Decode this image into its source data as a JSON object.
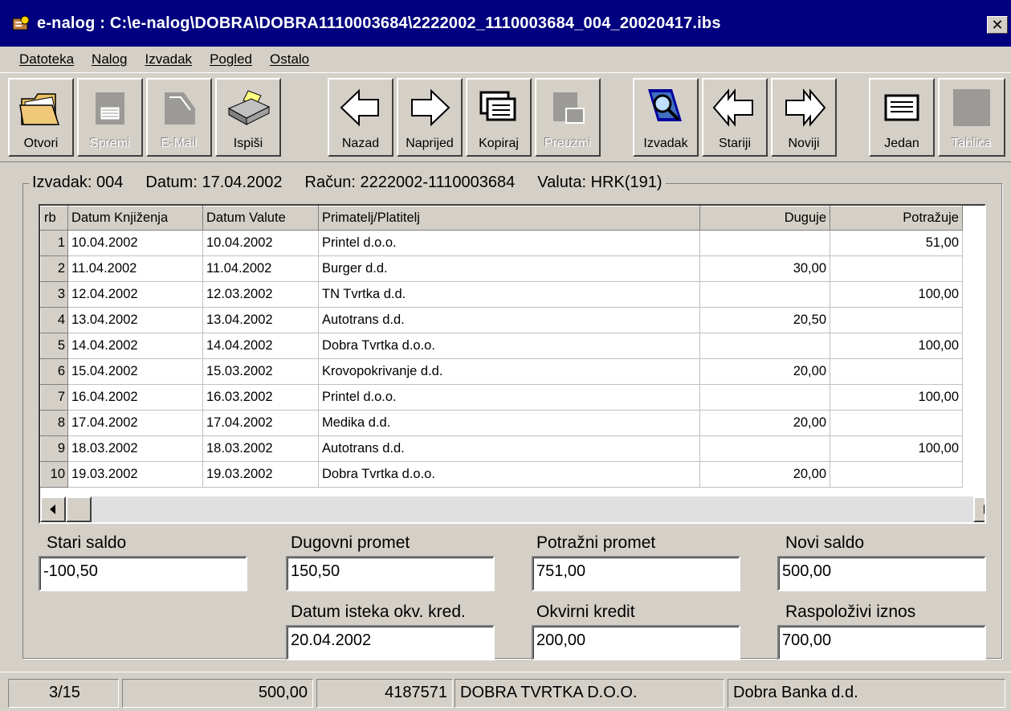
{
  "window": {
    "title": "e-nalog : C:\\e-nalog\\DOBRA\\DOBRA1110003684\\2222002_1110003684_004_20020417.ibs",
    "close_label": "✕"
  },
  "menu": {
    "items": [
      "Datoteka",
      "Nalog",
      "Izvadak",
      "Pogled",
      "Ostalo"
    ]
  },
  "toolbar": {
    "buttons": [
      {
        "label": "Otvori",
        "icon": "folder-icon",
        "enabled": true
      },
      {
        "label": "Spremi",
        "icon": "save-icon",
        "enabled": false
      },
      {
        "label": "E-Mail",
        "icon": "mail-icon",
        "enabled": false
      },
      {
        "label": "Ispiši",
        "icon": "printer-icon",
        "enabled": true
      },
      {
        "label": "Nazad",
        "icon": "arrow-left-icon",
        "enabled": true
      },
      {
        "label": "Naprijed",
        "icon": "arrow-right-icon",
        "enabled": true
      },
      {
        "label": "Kopiraj",
        "icon": "copy-icon",
        "enabled": true
      },
      {
        "label": "Preuzmi",
        "icon": "download-icon",
        "enabled": false
      },
      {
        "label": "Izvadak",
        "icon": "statement-search-icon",
        "enabled": true
      },
      {
        "label": "Stariji",
        "icon": "double-arrow-left-icon",
        "enabled": true
      },
      {
        "label": "Noviji",
        "icon": "double-arrow-right-icon",
        "enabled": true
      },
      {
        "label": "Jedan",
        "icon": "single-record-icon",
        "enabled": true
      },
      {
        "label": "Tablica",
        "icon": "table-icon",
        "enabled": false
      }
    ]
  },
  "statement": {
    "izvadak": "Izvadak: 004",
    "datum": "Datum: 17.04.2002",
    "racun": "Račun: 2222002-1110003684",
    "valuta": "Valuta: HRK(191)"
  },
  "grid": {
    "columns": {
      "rb": "rb",
      "datum_knjizenja": "Datum Knjiženja",
      "datum_valute": "Datum Valute",
      "primatelj": "Primatelj/Platitelj",
      "duguje": "Duguje",
      "potrazuje": "Potražuje"
    },
    "rows": [
      {
        "rb": "1",
        "dk": "10.04.2002",
        "dv": "10.04.2002",
        "name": "Printel d.o.o.",
        "duguje": "",
        "potrazuje": "51,00"
      },
      {
        "rb": "2",
        "dk": "11.04.2002",
        "dv": "11.04.2002",
        "name": "Burger d.d.",
        "duguje": "30,00",
        "potrazuje": ""
      },
      {
        "rb": "3",
        "dk": "12.04.2002",
        "dv": "12.03.2002",
        "name": "TN Tvrtka d.d.",
        "duguje": "",
        "potrazuje": "100,00"
      },
      {
        "rb": "4",
        "dk": "13.04.2002",
        "dv": "13.04.2002",
        "name": "Autotrans d.d.",
        "duguje": "20,50",
        "potrazuje": ""
      },
      {
        "rb": "5",
        "dk": "14.04.2002",
        "dv": "14.04.2002",
        "name": "Dobra Tvrtka d.o.o.",
        "duguje": "",
        "potrazuje": "100,00"
      },
      {
        "rb": "6",
        "dk": "15.04.2002",
        "dv": "15.03.2002",
        "name": "Krovopokrivanje d.d.",
        "duguje": "20,00",
        "potrazuje": ""
      },
      {
        "rb": "7",
        "dk": "16.04.2002",
        "dv": "16.03.2002",
        "name": "Printel d.o.o.",
        "duguje": "",
        "potrazuje": "100,00"
      },
      {
        "rb": "8",
        "dk": "17.04.2002",
        "dv": "17.04.2002",
        "name": "Medika d.d.",
        "duguje": "20,00",
        "potrazuje": ""
      },
      {
        "rb": "9",
        "dk": "18.03.2002",
        "dv": "18.03.2002",
        "name": "Autotrans d.d.",
        "duguje": "",
        "potrazuje": "100,00"
      },
      {
        "rb": "10",
        "dk": "19.03.2002",
        "dv": "19.03.2002",
        "name": "Dobra Tvrtka d.o.o.",
        "duguje": "20,00",
        "potrazuje": ""
      }
    ]
  },
  "totals": {
    "stari_saldo_label": "Stari saldo",
    "stari_saldo": "-100,50",
    "dugovni_promet_label": "Dugovni promet",
    "dugovni_promet": "150,50",
    "potrazni_promet_label": "Potražni promet",
    "potrazni_promet": "751,00",
    "novi_saldo_label": "Novi saldo",
    "novi_saldo": "500,00",
    "datum_isteka_label": "Datum isteka okv. kred.",
    "datum_isteka": "20.04.2002",
    "okvirni_kredit_label": "Okvirni kredit",
    "okvirni_kredit": "200,00",
    "raspolozivi_label": "Raspoloživi iznos",
    "raspolozivi": "700,00"
  },
  "status": {
    "position": "3/15",
    "empty": "",
    "amount": "500,00",
    "account_id": "4187571",
    "company": "DOBRA TVRTKA D.O.O.",
    "bank": "Dobra Banka d.d."
  }
}
